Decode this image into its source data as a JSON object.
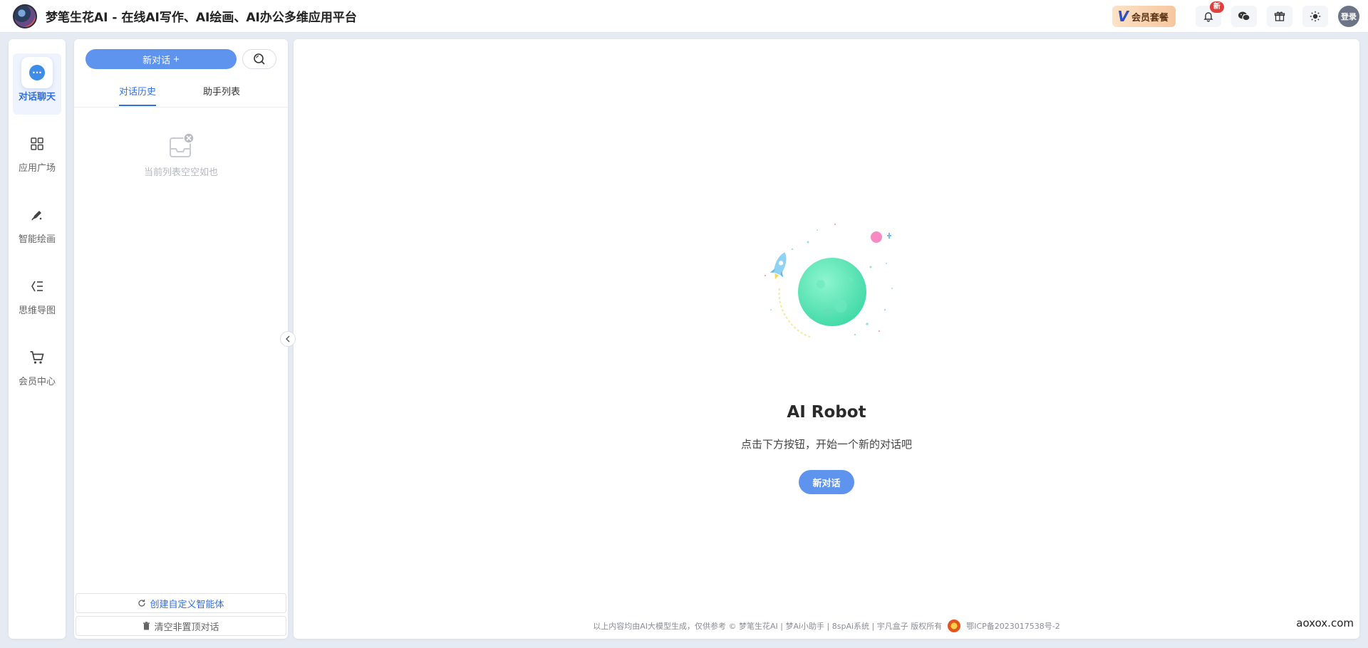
{
  "header": {
    "title": "梦笔生花AI - 在线AI写作、AI绘画、AI办公多维应用平台",
    "vip_label": "会员套餐",
    "vip_letter": "V",
    "notification_badge": "新",
    "login_label": "登录"
  },
  "nav": {
    "items": [
      {
        "label": "对话聊天",
        "icon": "chat-bubble-icon",
        "active": true
      },
      {
        "label": "应用广场",
        "icon": "grid-icon",
        "active": false
      },
      {
        "label": "智能绘画",
        "icon": "brush-icon",
        "active": false
      },
      {
        "label": "思维导图",
        "icon": "mindmap-icon",
        "active": false
      },
      {
        "label": "会员中心",
        "icon": "cart-icon",
        "active": false
      }
    ]
  },
  "list_panel": {
    "new_chat_label": "新对话",
    "new_chat_plus": "+",
    "tabs": [
      {
        "label": "对话历史",
        "active": true
      },
      {
        "label": "助手列表",
        "active": false
      }
    ],
    "empty_text": "当前列表空空如也",
    "create_agent_label": "创建自定义智能体",
    "clear_label": "清空非置顶对话"
  },
  "main": {
    "title": "AI Robot",
    "subtitle": "点击下方按钮，开始一个新的对话吧",
    "new_chat_button": "新对话"
  },
  "footer": {
    "text": "以上内容均由AI大模型生成，仅供参考 © 梦笔生花AI | 梦Ai小助手 | 8spAi系统 | 宇凡盒子  版权所有",
    "icp": "鄂ICP备2023017538号-2"
  },
  "watermark": "aoxox.com",
  "colors": {
    "accent": "#2f6fe2",
    "button": "#5f94ee",
    "planet": "#4fe0b0",
    "badge": "#e0403b"
  }
}
